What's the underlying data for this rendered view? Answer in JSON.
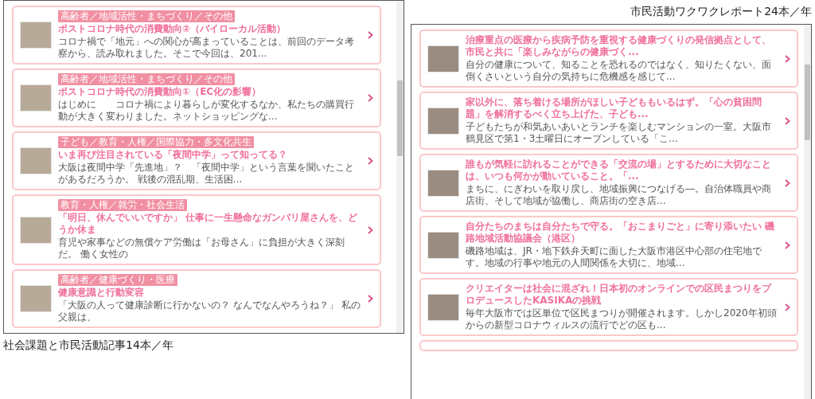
{
  "left_screenshot": {
    "articles": [
      {
        "tag": "高齢者／地域活性・まちづくり／その他",
        "title": "ポストコロナ時代の消費動向②（バイローカル活動）",
        "summary": "コロナ禍で「地元」への関心が高まっていることは、前回のデータ考察から、読み取れました。そこで今回は、201..."
      },
      {
        "tag": "高齢者／地域活性・まちづくり／その他",
        "title": "ポストコロナ時代の消費動向①（EC化の影響）",
        "summary": "はじめに　　コロナ禍により暮らしが変化するなか、私たちの購買行動が大きく変わりました。ネットショッピングな..."
      },
      {
        "tag": "子ども／教育・人権／国際協力・多文化共生",
        "title": "いま再び注目されている「夜間中学」って知ってる？",
        "summary": "大阪は夜間中学「先進地」？　「夜間中学」という言葉を聞いたことがあるだろうか。 戦後の混乱期、生活困..."
      },
      {
        "tag": "教育・人権／就労・社会生活",
        "title": "「明日、休んでいいですか」 仕事に一生懸命なガンバリ屋さんを、どうか休ま",
        "summary": "育児や家事などの無償ケア労働は「お母さん」に負担が大きく深刻だ。 働く女性の"
      },
      {
        "tag": "高齢者／健康づくり・医療",
        "title": "健康意識と行動変容",
        "summary": "「大阪の人って健康診断に行かないの？ なんでなんやろうね？」 私の父親は、"
      }
    ]
  },
  "left_caption": "社会課題と市民活動記事14本／年",
  "right_caption": "市民活動ワクワクレポート24本／年",
  "right_screenshot": {
    "articles": [
      {
        "title": "治療重点の医療から疾病予防を重視する健康づくりの発信拠点として、市民と共に「楽しみながらの健康づく...",
        "summary": "自分の健康について、知ることを恐れるのではなく、知りたくない、面倒くさいという自分の気持ちに危機感を感じて..."
      },
      {
        "title": "家以外に、落ち着ける場所がほしい子どももいるはず。「心の貧困問題」を解消するべく立ち上げた、子ども...",
        "summary": "子どもたちが和気あいあいとランチを楽しむマンションの一室。大阪市鶴見区で第1・3土曜日にオープンしている「こ..."
      },
      {
        "title": "誰もが気軽に訪れることができる「交流の場」とするために大切なことは、いつも何かが動いていること。「...",
        "summary": "まちに、にぎわいを取り戻し、地域振興につなげる―。自治体職員や商店街、そして地域が協働し、商店街の空き店..."
      },
      {
        "title": "自分たちのまちは自分たちで守る。「おこまりごと」に寄り添いたい 磯路地域活動協議会（港区）",
        "summary": "磯路地域は、JR・地下鉄弁天町に面した大阪市港区中心部の住宅地です。地域の行事や地元の人間関係を大切に、地域..."
      },
      {
        "title": "クリエイターは社会に混ざれ！日本初のオンラインでの区民まつりをプロデュースしたKASIKAの挑戦",
        "summary": "毎年大阪市では区単位で区民まつりが開催されます。しかし2020年初頭からの新型コロナウィルスの流行でどの区も..."
      }
    ]
  }
}
